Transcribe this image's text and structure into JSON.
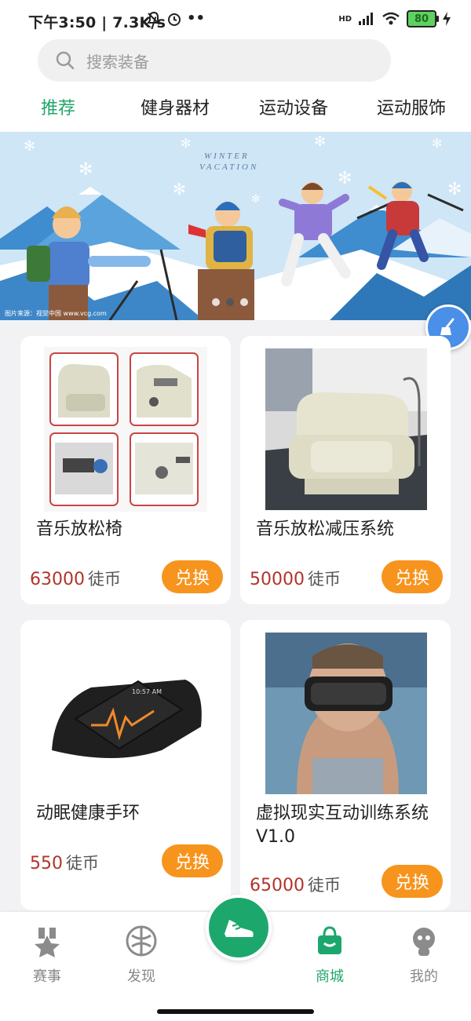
{
  "status_bar": {
    "time": "下午3:50",
    "speed": "7.3K/s",
    "network": "HD",
    "battery": "80"
  },
  "search": {
    "placeholder": "搜索装备",
    "icon": "search-icon"
  },
  "tabs": [
    {
      "label": "推荐",
      "active": true
    },
    {
      "label": "健身器材",
      "active": false
    },
    {
      "label": "运动设备",
      "active": false
    },
    {
      "label": "运动服饰",
      "active": false
    }
  ],
  "banner": {
    "title_line1": "WINTER",
    "title_line2": "VACATION",
    "caption": "图片来源：视觉中国 www.vcg.com",
    "slide_count": 3,
    "active_slide": 2
  },
  "products": [
    {
      "name": "音乐放松椅",
      "price": "63000",
      "unit": "徒币",
      "action": "兑换"
    },
    {
      "name": "音乐放松减压系统",
      "price": "50000",
      "unit": "徒币",
      "action": "兑换"
    },
    {
      "name": "动眠健康手环",
      "price": "550",
      "unit": "徒币",
      "action": "兑换",
      "image_text": "10:57 AM"
    },
    {
      "name": "虚拟现实互动训练系统V1.0",
      "price": "65000",
      "unit": "徒币",
      "action": "兑换"
    }
  ],
  "bottom_nav": [
    {
      "label": "赛事",
      "icon": "medal-icon",
      "active": false
    },
    {
      "label": "发现",
      "icon": "discover-icon",
      "active": false
    },
    {
      "label": "",
      "icon": "running-shoe-icon",
      "active": false
    },
    {
      "label": "商城",
      "icon": "shopping-bag-icon",
      "active": true
    },
    {
      "label": "我的",
      "icon": "profile-icon",
      "active": false
    }
  ],
  "colors": {
    "accent": "#20a66a",
    "exchange_button": "#f7941d",
    "price": "#b1342a",
    "fab": "#4a8fe8"
  }
}
